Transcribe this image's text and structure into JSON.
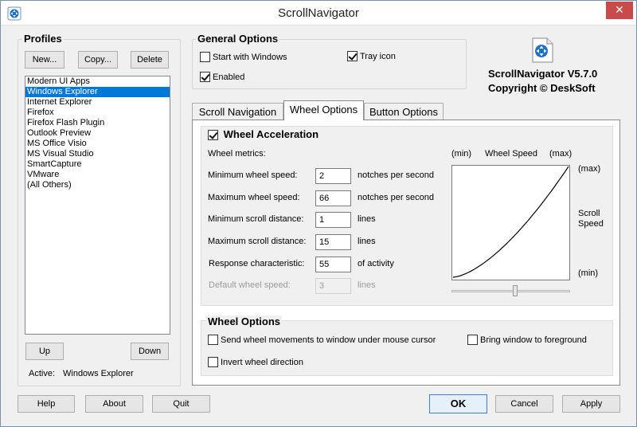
{
  "window": {
    "title": "ScrollNavigator",
    "close_label": "✕"
  },
  "profiles": {
    "title": "Profiles",
    "new_label": "New...",
    "copy_label": "Copy...",
    "delete_label": "Delete",
    "items": [
      "Modern UI Apps",
      "Windows Explorer",
      "Internet Explorer",
      "Firefox",
      "Firefox Flash Plugin",
      "Outlook Preview",
      "MS Office Visio",
      "MS Visual Studio",
      "SmartCapture",
      "VMware",
      "(All Others)"
    ],
    "selected_index": 1,
    "up_label": "Up",
    "down_label": "Down",
    "active_label": "Active:",
    "active_value": "Windows Explorer"
  },
  "general": {
    "title": "General Options",
    "start_with_windows": {
      "label": "Start with Windows",
      "checked": false
    },
    "tray_icon": {
      "label": "Tray icon",
      "checked": true
    },
    "enabled": {
      "label": "Enabled",
      "checked": true
    }
  },
  "about": {
    "version": "ScrollNavigator V5.7.0",
    "copyright": "Copyright © DeskSoft"
  },
  "tabs": [
    {
      "label": "Scroll Navigation",
      "active": false
    },
    {
      "label": "Wheel Options",
      "active": true
    },
    {
      "label": "Button Options",
      "active": false
    }
  ],
  "wheel_accel": {
    "title": "Wheel Acceleration",
    "checked": true,
    "metrics_label": "Wheel metrics:",
    "rows": [
      {
        "label": "Minimum wheel speed:",
        "value": "2",
        "unit": "notches per second",
        "enabled": true
      },
      {
        "label": "Maximum wheel speed:",
        "value": "66",
        "unit": "notches per second",
        "enabled": true
      },
      {
        "label": "Minimum scroll distance:",
        "value": "1",
        "unit": "lines",
        "enabled": true
      },
      {
        "label": "Maximum scroll distance:",
        "value": "15",
        "unit": "lines",
        "enabled": true
      },
      {
        "label": "Response characteristic:",
        "value": "55",
        "unit": "of activity",
        "enabled": true
      },
      {
        "label": "Default wheel speed:",
        "value": "3",
        "unit": "lines",
        "enabled": false
      }
    ],
    "chart": {
      "x_min_label": "(min)",
      "x_title": "Wheel Speed",
      "x_max_label": "(max)",
      "y_max_label": "(max)",
      "y_title_line1": "Scroll",
      "y_title_line2": "Speed",
      "y_min_label": "(min)",
      "curve_exponent": 1.55
    },
    "slider_value_percent": 54
  },
  "wheel_options": {
    "title": "Wheel Options",
    "send_to_cursor": {
      "label": "Send wheel movements to window under mouse cursor",
      "checked": false
    },
    "bring_to_front": {
      "label": "Bring window to foreground",
      "checked": false
    },
    "invert": {
      "label": "Invert wheel direction",
      "checked": false
    }
  },
  "footer": {
    "help_label": "Help",
    "about_label": "About",
    "quit_label": "Quit",
    "ok_label": "OK",
    "cancel_label": "Cancel",
    "apply_label": "Apply"
  },
  "colors": {
    "selection": "#0078d7",
    "close_button": "#c94a4a",
    "icon_blue": "#1f6fc9"
  }
}
